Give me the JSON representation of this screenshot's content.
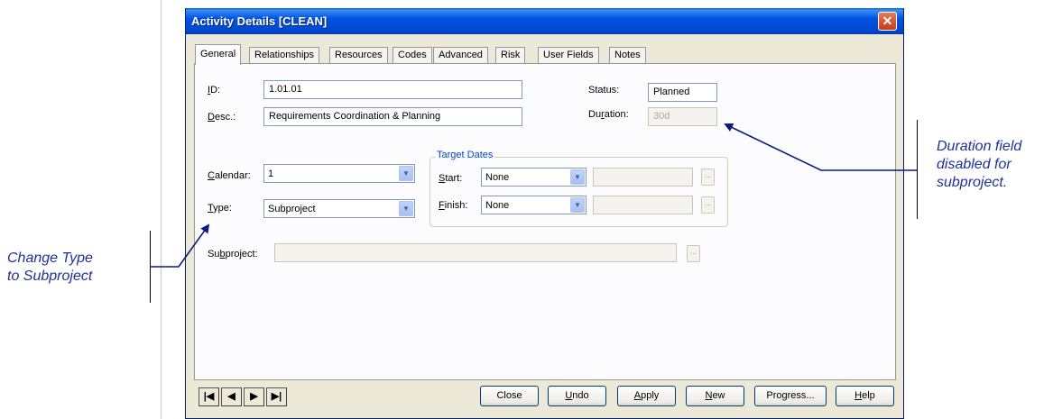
{
  "window": {
    "title": "Activity Details [CLEAN]",
    "close_glyph": "✕"
  },
  "tabs": [
    {
      "label": "General",
      "active": true
    },
    {
      "label": "Relationships"
    },
    {
      "label": "Resources"
    },
    {
      "label": "Codes"
    },
    {
      "label": "Advanced"
    },
    {
      "label": "Risk"
    },
    {
      "label": "User Fields"
    },
    {
      "label": "Notes"
    }
  ],
  "general": {
    "id_label_u": "I",
    "id_label_rest": "D:",
    "id_value": "1.01.01",
    "desc_label_u": "D",
    "desc_label_rest": "esc.:",
    "desc_value": "Requirements Coordination & Planning",
    "status_label": "Status:",
    "status_value": "Planned",
    "duration_label_a": "Du",
    "duration_label_u": "r",
    "duration_label_b": "ation:",
    "duration_value": "30d",
    "calendar_label_u": "C",
    "calendar_label_rest": "alendar:",
    "calendar_value": "1",
    "type_label_u": "T",
    "type_label_rest": "ype:",
    "type_value": "Subproject",
    "target_dates_title": "Target Dates",
    "start_label_u": "S",
    "start_label_rest": "tart:",
    "start_value": "None",
    "finish_label_u": "F",
    "finish_label_rest": "inish:",
    "finish_value": "None",
    "subproject_label_a": "Su",
    "subproject_label_u": "b",
    "subproject_label_b": "project:",
    "subproject_value": "",
    "ellipsis_glyph": "..."
  },
  "nav": {
    "first": "|◀",
    "prev": "◀",
    "next": "▶",
    "last": "▶|"
  },
  "buttons": {
    "close": "Close",
    "undo_u": "U",
    "undo_rest": "ndo",
    "apply_u": "A",
    "apply_rest": "pply",
    "new_u": "N",
    "new_rest": "ew",
    "progress": "Progress...",
    "help_u": "H",
    "help_rest": "elp"
  },
  "annotations": {
    "left_line1": "Change Type",
    "left_line2": "to Subproject",
    "right_line1": "Duration field",
    "right_line2": "disabled for",
    "right_line3": "subproject."
  },
  "colors": {
    "annotation": "#1f2f9f",
    "title_bar": "#0054e3"
  }
}
